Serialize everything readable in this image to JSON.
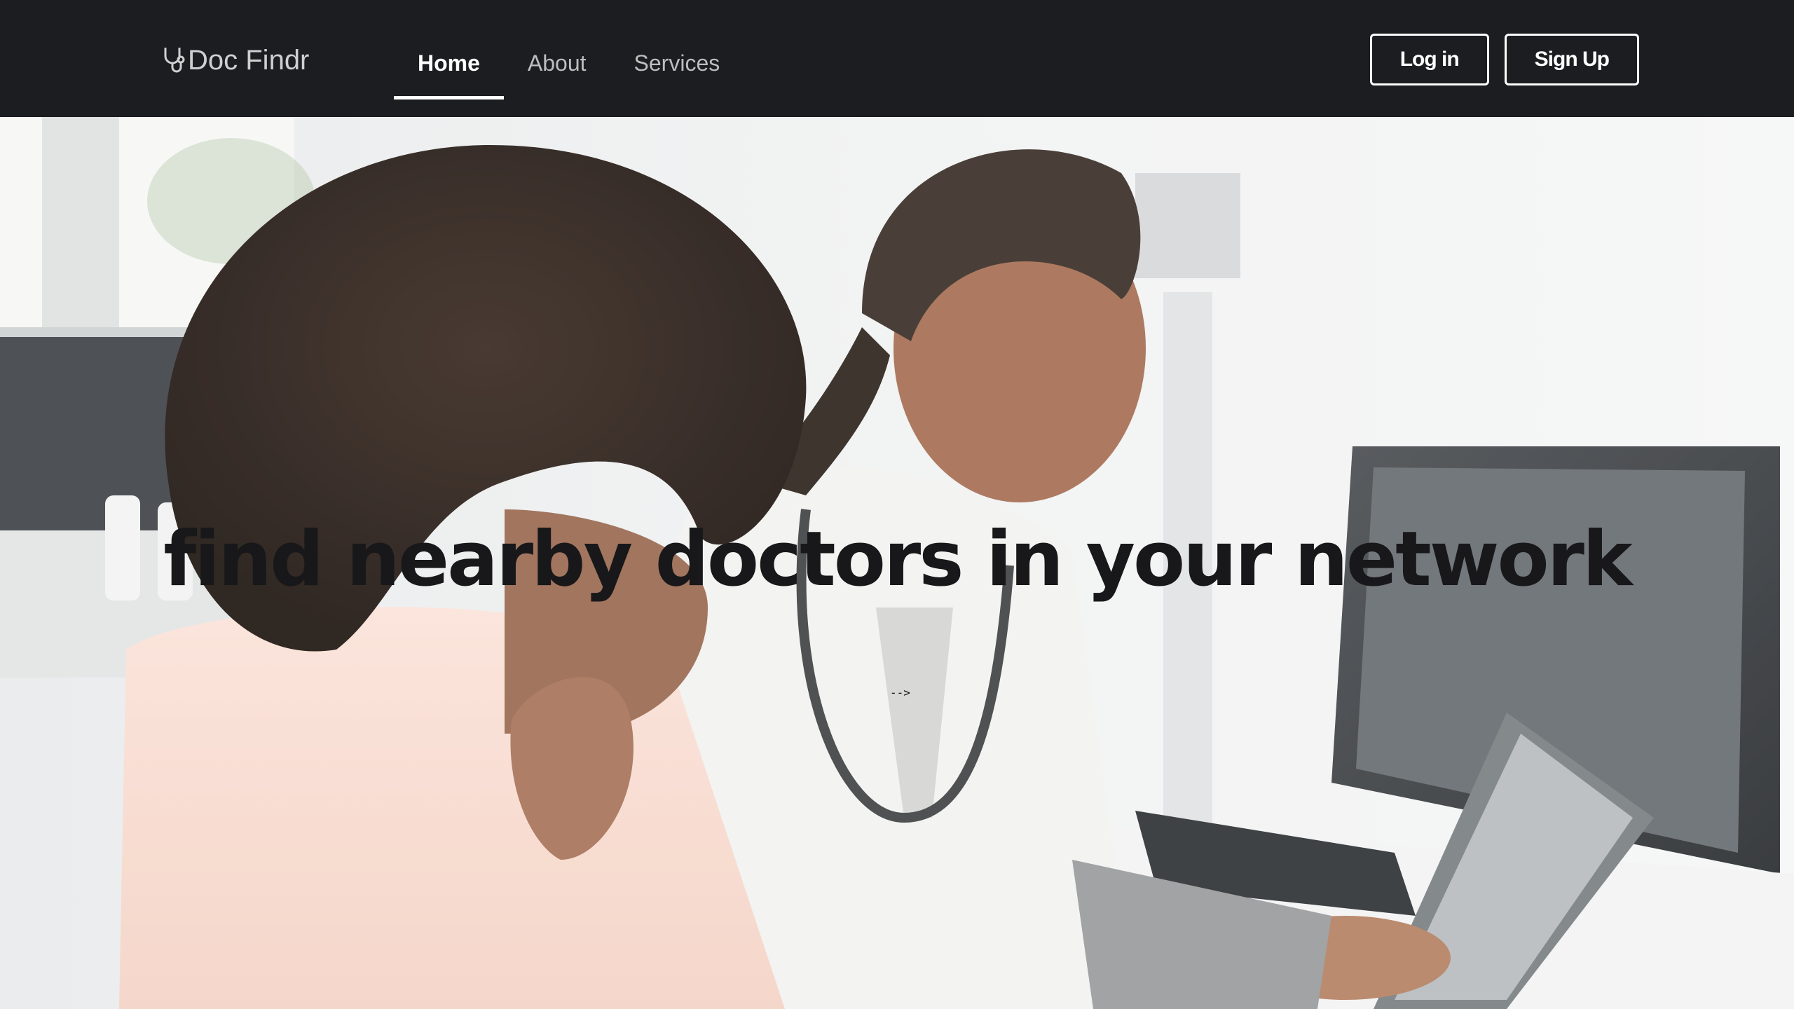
{
  "brand": {
    "name": "Doc Findr",
    "icon": "stethoscope-icon"
  },
  "nav": {
    "items": [
      {
        "label": "Home",
        "active": true
      },
      {
        "label": "About",
        "active": false
      },
      {
        "label": "Services",
        "active": false
      }
    ]
  },
  "auth": {
    "login_label": "Log in",
    "signup_label": "Sign Up"
  },
  "hero": {
    "title": "find nearby doctors in your network",
    "stray_text": "-->"
  },
  "colors": {
    "navbar_bg": "#1c1d20",
    "title_color": "#18181a",
    "nav_active": "#ffffff",
    "nav_inactive": "#bdbdbd"
  }
}
